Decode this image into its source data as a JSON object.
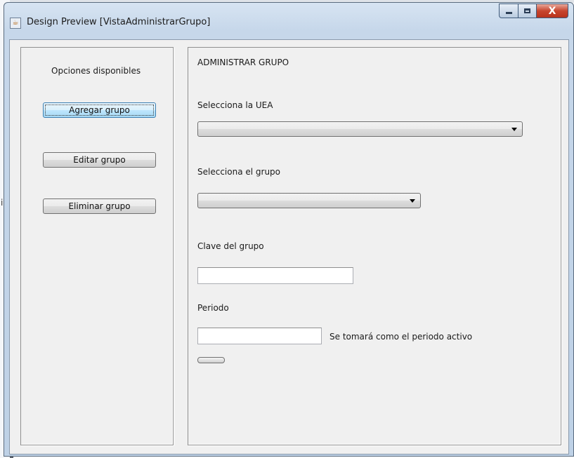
{
  "background": {
    "partial_text": "ia"
  },
  "window": {
    "title": "Design Preview [VistaAdministrarGrupo]",
    "icon": "java-cup-icon",
    "controls": {
      "minimize_icon": "minimize-icon",
      "maximize_icon": "maximize-icon",
      "close_icon": "close-icon",
      "close_glyph": "X"
    }
  },
  "sidebar": {
    "heading": "Opciones disponibles",
    "buttons": [
      {
        "label": "Agregar grupo",
        "focused": true
      },
      {
        "label": "Editar grupo",
        "focused": false
      },
      {
        "label": "Eliminar grupo",
        "focused": false
      }
    ]
  },
  "main": {
    "title": "ADMINISTRAR GRUPO",
    "uea": {
      "label": "Selecciona la UEA",
      "selected": ""
    },
    "grupo": {
      "label": "Selecciona el grupo",
      "selected": ""
    },
    "clave": {
      "label": "Clave del grupo",
      "value": ""
    },
    "periodo": {
      "label": "Periodo",
      "value": "",
      "hint": "Se tomará como el periodo activo"
    },
    "action_button": {
      "label": ""
    }
  },
  "colors": {
    "panel_background": "#f0f0f0",
    "title_bar": "#c6d7ea",
    "close_button": "#c7452e",
    "focus_button": "#bee6fd"
  }
}
